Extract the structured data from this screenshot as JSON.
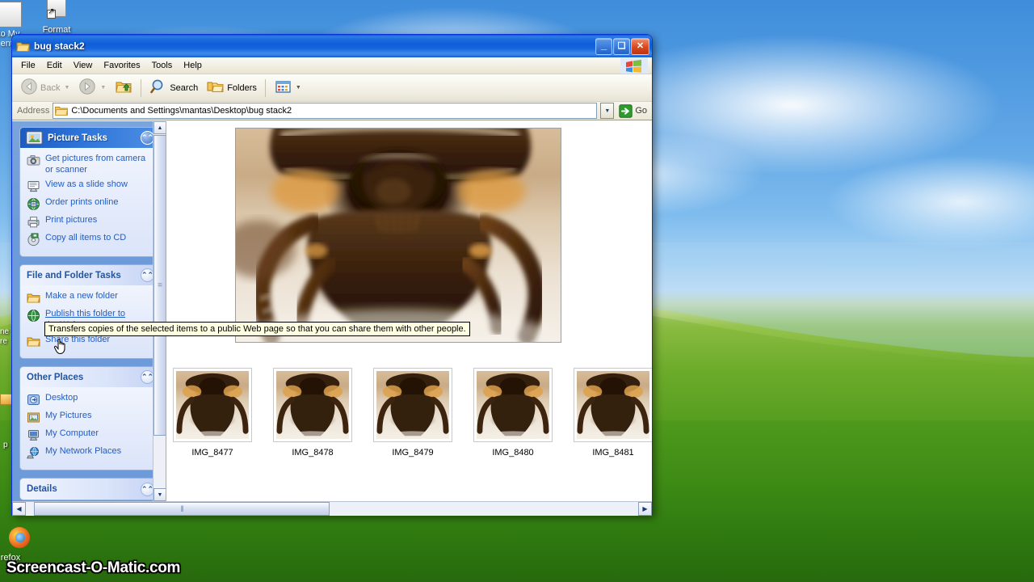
{
  "desktop": {
    "icons": [
      {
        "label": "to My\nents",
        "name": "desktop-icon-partial-left-top"
      },
      {
        "label": "Format\nFactory",
        "name": "desktop-icon-format-factory"
      },
      {
        "label": "refox",
        "name": "desktop-icon-firefox-partial"
      }
    ],
    "watermark": "Screencast-O-Matic.com"
  },
  "window": {
    "title": "bug stack2",
    "titlebar_buttons": {
      "minimize": "_",
      "maximize": "❑",
      "close": "✕"
    },
    "menu": [
      {
        "label": "File",
        "name": "menu-file"
      },
      {
        "label": "Edit",
        "name": "menu-edit"
      },
      {
        "label": "View",
        "name": "menu-view"
      },
      {
        "label": "Favorites",
        "name": "menu-favorites"
      },
      {
        "label": "Tools",
        "name": "menu-tools"
      },
      {
        "label": "Help",
        "name": "menu-help"
      }
    ],
    "toolbar": {
      "back": "Back",
      "search": "Search",
      "folders": "Folders"
    },
    "address": {
      "label": "Address",
      "value": "C:\\Documents and Settings\\mantas\\Desktop\\bug stack2",
      "go": "Go"
    }
  },
  "sidebar": {
    "panels": [
      {
        "title": "Picture Tasks",
        "style": "blue",
        "tasks": [
          {
            "label": "Get pictures from camera or scanner",
            "icon": "camera-icon"
          },
          {
            "label": "View as a slide show",
            "icon": "slideshow-icon"
          },
          {
            "label": "Order prints online",
            "icon": "globe-print-icon"
          },
          {
            "label": "Print pictures",
            "icon": "printer-icon"
          },
          {
            "label": "Copy all items to CD",
            "icon": "cd-icon"
          }
        ]
      },
      {
        "title": "File and Folder Tasks",
        "style": "light",
        "tasks": [
          {
            "label": "Make a new folder",
            "icon": "folder-new-icon"
          },
          {
            "label": "Publish this folder to the Web",
            "icon": "publish-web-icon",
            "hovered": true
          },
          {
            "label": "Share this folder",
            "icon": "folder-share-icon"
          }
        ]
      },
      {
        "title": "Other Places",
        "style": "light",
        "tasks": [
          {
            "label": "Desktop",
            "icon": "desktop-icon"
          },
          {
            "label": "My Pictures",
            "icon": "my-pictures-icon"
          },
          {
            "label": "My Computer",
            "icon": "my-computer-icon"
          },
          {
            "label": "My Network Places",
            "icon": "network-places-icon"
          }
        ]
      },
      {
        "title": "Details",
        "style": "light",
        "tasks": []
      }
    ]
  },
  "tooltip": {
    "text": "Transfers copies of the selected items to a public Web page so that you can share them with other people."
  },
  "content": {
    "thumbnails": [
      {
        "caption": "IMG_8477"
      },
      {
        "caption": "IMG_8478"
      },
      {
        "caption": "IMG_8479"
      },
      {
        "caption": "IMG_8480"
      },
      {
        "caption": "IMG_8481"
      }
    ]
  },
  "colors": {
    "title_blue": "#0a5ad4",
    "sidebar_blue": "#6d9ad8",
    "link_blue": "#215dc6",
    "panel_head_blue": "#1c5ac4",
    "tooltip_bg": "#ffffe1"
  }
}
